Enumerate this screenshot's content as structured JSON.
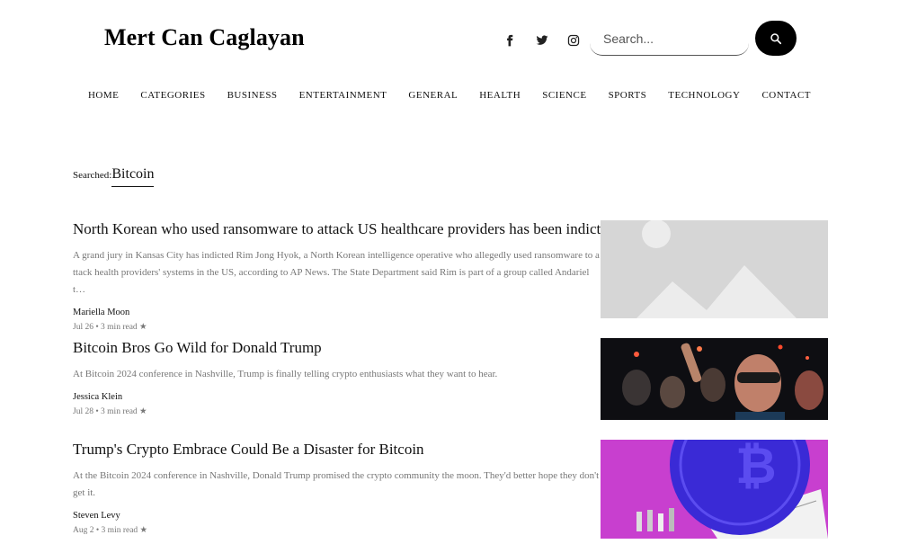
{
  "site": {
    "title": "Mert Can Caglayan"
  },
  "social": [
    {
      "name": "facebook-icon"
    },
    {
      "name": "twitter-icon"
    },
    {
      "name": "instagram-icon"
    }
  ],
  "search": {
    "placeholder": "Search...",
    "value": ""
  },
  "nav": [
    "HOME",
    "CATEGORIES",
    "BUSINESS",
    "ENTERTAINMENT",
    "GENERAL",
    "HEALTH",
    "SCIENCE",
    "SPORTS",
    "TECHNOLOGY",
    "CONTACT"
  ],
  "results": {
    "label": "Searched:",
    "term": "Bitcoin"
  },
  "articles": [
    {
      "title": "North Korean who used ransomware to attack US healthcare providers has been indicted",
      "excerpt": "A grand jury in Kansas City has indicted Rim Jong Hyok, a North Korean intelligence operative who allegedly used ransomware to attack health providers' systems in the US, according to AP News. The State Department said Rim is part of a group called Andariel t…",
      "author": "Mariella Moon",
      "meta": "Jul 26 • 3 min read ★",
      "image": "placeholder-image"
    },
    {
      "title": "Bitcoin Bros Go Wild for Donald Trump",
      "excerpt": "At Bitcoin 2024 conference in Nashville, Trump is finally telling crypto enthusiasts what they want to hear.",
      "author": "Jessica Klein",
      "meta": "Jul 28 • 3 min read ★",
      "image": "crowd-photo"
    },
    {
      "title": "Trump's Crypto Embrace Could Be a Disaster for Bitcoin",
      "excerpt": "At the Bitcoin 2024 conference in Nashville, Donald Trump promised the crypto community the moon. They'd better hope they don't get it.",
      "author": "Steven Levy",
      "meta": "Aug 2 • 3 min read ★",
      "image": "bitcoin-collage"
    }
  ]
}
